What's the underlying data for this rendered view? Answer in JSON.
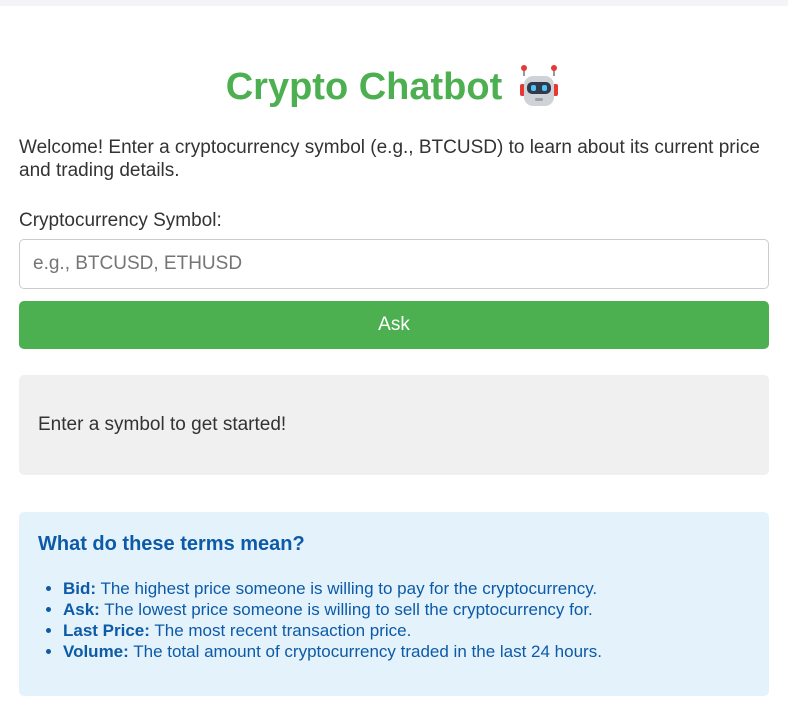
{
  "header": {
    "title": "Crypto Chatbot",
    "icon": "robot-icon"
  },
  "intro": {
    "welcome_text": "Welcome! Enter a cryptocurrency symbol (e.g., BTCUSD) to learn about its current price and trading details."
  },
  "form": {
    "symbol_label": "Cryptocurrency Symbol:",
    "symbol_value": "",
    "symbol_placeholder": "e.g., BTCUSD, ETHUSD",
    "ask_label": "Ask"
  },
  "response": {
    "text": "Enter a symbol to get started!"
  },
  "glossary": {
    "title": "What do these terms mean?",
    "items": [
      {
        "term": "Bid:",
        "definition": " The highest price someone is willing to pay for the cryptocurrency."
      },
      {
        "term": "Ask:",
        "definition": " The lowest price someone is willing to sell the cryptocurrency for."
      },
      {
        "term": "Last Price:",
        "definition": " The most recent transaction price."
      },
      {
        "term": "Volume:",
        "definition": " The total amount of cryptocurrency traded in the last 24 hours."
      }
    ]
  },
  "colors": {
    "accent": "#4caf50",
    "glossary_background": "#e3f2fb",
    "glossary_text": "#0d5aa7",
    "response_background": "#f0f0f0"
  }
}
